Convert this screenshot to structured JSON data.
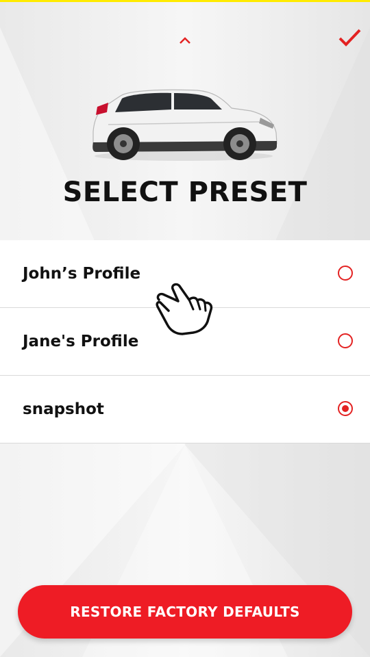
{
  "header": {
    "collapse_icon": "chevron-up-icon",
    "confirm_icon": "checkmark-icon",
    "title": "SELECT PRESET"
  },
  "presets": [
    {
      "label": "John’s Profile",
      "selected": false
    },
    {
      "label": "Jane's Profile",
      "selected": false
    },
    {
      "label": "snapshot",
      "selected": true
    }
  ],
  "footer": {
    "restore_label": "RESTORE FACTORY DEFAULTS"
  },
  "colors": {
    "accent": "#ee1c25",
    "top_bar": "#ffeb00"
  }
}
